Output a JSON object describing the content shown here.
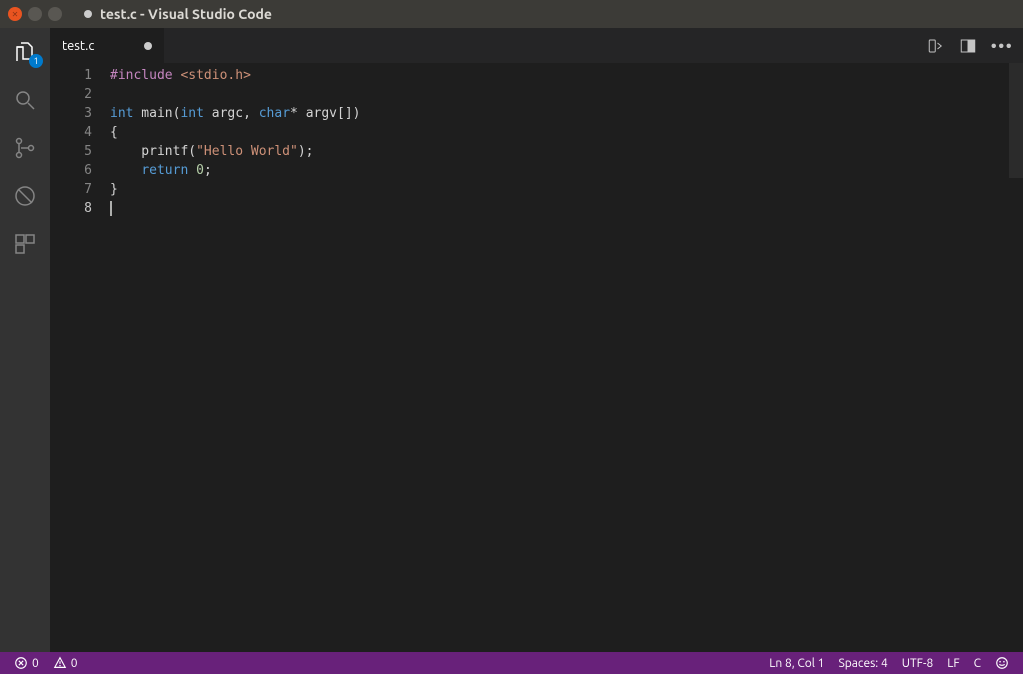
{
  "window": {
    "title": "test.c - Visual Studio Code",
    "modified": true
  },
  "activitybar": {
    "explorer_badge": "1"
  },
  "tabs": [
    {
      "label": "test.c",
      "modified": true,
      "active": true
    }
  ],
  "editor": {
    "line_count": 8,
    "tokens": {
      "l1_pp": "#include",
      "l1_inc": "<stdio.h>",
      "l3_kw1": "int",
      "l3_id1": " main(",
      "l3_kw2": "int",
      "l3_id2": " argc, ",
      "l3_kw3": "char",
      "l3_id3": "* argv[])",
      "l4": "{",
      "l5_id1": "    printf(",
      "l5_str": "\"Hello World\"",
      "l5_id2": ");",
      "l6_id1": "    ",
      "l6_kw": "return",
      "l6_sp": " ",
      "l6_num": "0",
      "l6_id2": ";",
      "l7": "}"
    }
  },
  "statusbar": {
    "errors": "0",
    "warnings": "0",
    "position": "Ln 8, Col 1",
    "indent": "Spaces: 4",
    "encoding": "UTF-8",
    "eol": "LF",
    "language": "C"
  }
}
